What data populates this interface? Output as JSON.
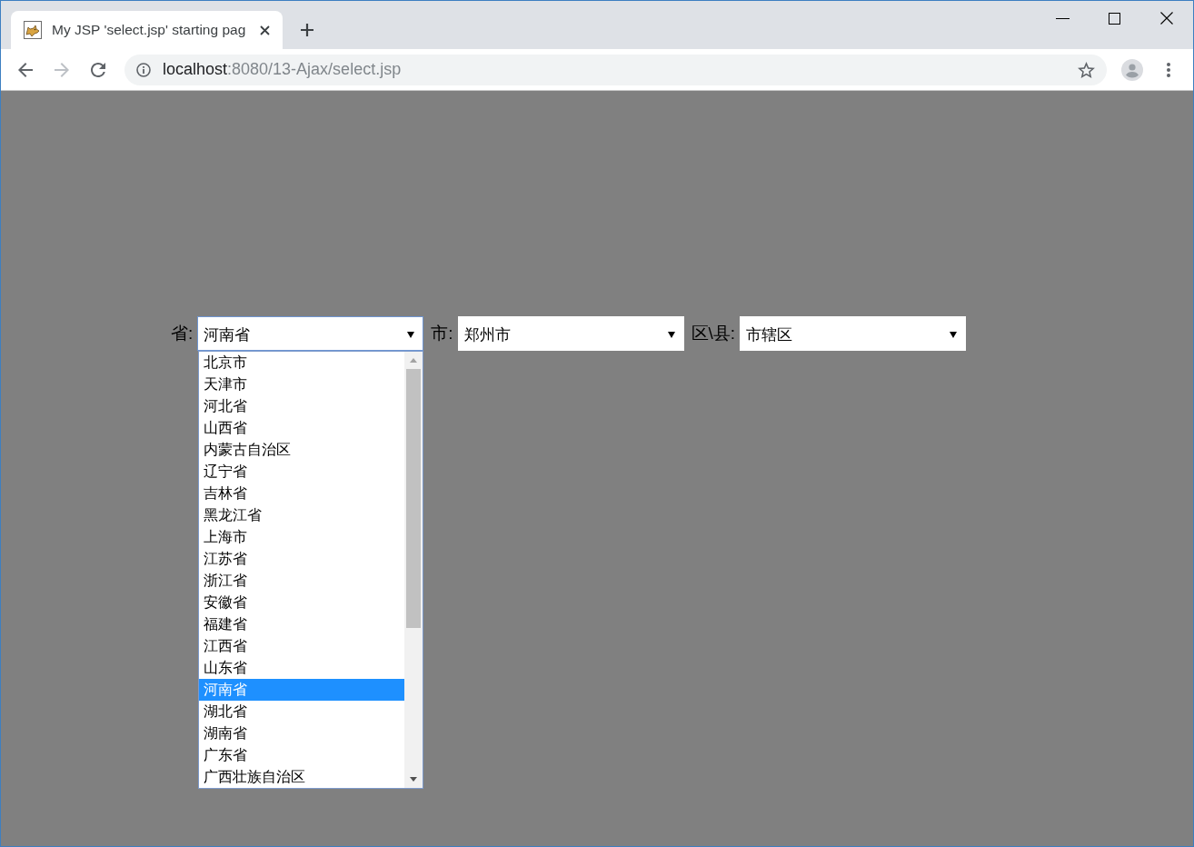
{
  "window": {
    "tab": {
      "title": "My JSP 'select.jsp' starting pag",
      "selected": true
    }
  },
  "toolbar": {
    "nav_buttons": [
      {
        "kind": "back",
        "disabled": false
      },
      {
        "kind": "forward",
        "disabled": true
      },
      {
        "kind": "reload",
        "disabled": false
      }
    ],
    "address": {
      "host": "localhost",
      "path": ":8080/13-Ajax/select.jsp"
    }
  },
  "form": {
    "fields": [
      {
        "label": "省:",
        "value": "河南省",
        "focused": true,
        "options": [
          {
            "label": "北京市",
            "selected": false
          },
          {
            "label": "天津市",
            "selected": false
          },
          {
            "label": "河北省",
            "selected": false
          },
          {
            "label": "山西省",
            "selected": false
          },
          {
            "label": "内蒙古自治区",
            "selected": false
          },
          {
            "label": "辽宁省",
            "selected": false
          },
          {
            "label": "吉林省",
            "selected": false
          },
          {
            "label": "黑龙江省",
            "selected": false
          },
          {
            "label": "上海市",
            "selected": false
          },
          {
            "label": "江苏省",
            "selected": false
          },
          {
            "label": "浙江省",
            "selected": false
          },
          {
            "label": "安徽省",
            "selected": false
          },
          {
            "label": "福建省",
            "selected": false
          },
          {
            "label": "江西省",
            "selected": false
          },
          {
            "label": "山东省",
            "selected": false
          },
          {
            "label": "河南省",
            "selected": true
          },
          {
            "label": "湖北省",
            "selected": false
          },
          {
            "label": "湖南省",
            "selected": false
          },
          {
            "label": "广东省",
            "selected": false
          },
          {
            "label": "广西壮族自治区",
            "selected": false
          }
        ]
      },
      {
        "label": "市:",
        "value": "郑州市",
        "focused": false
      },
      {
        "label": "区\\县:",
        "value": "市辖区",
        "focused": false
      }
    ]
  }
}
